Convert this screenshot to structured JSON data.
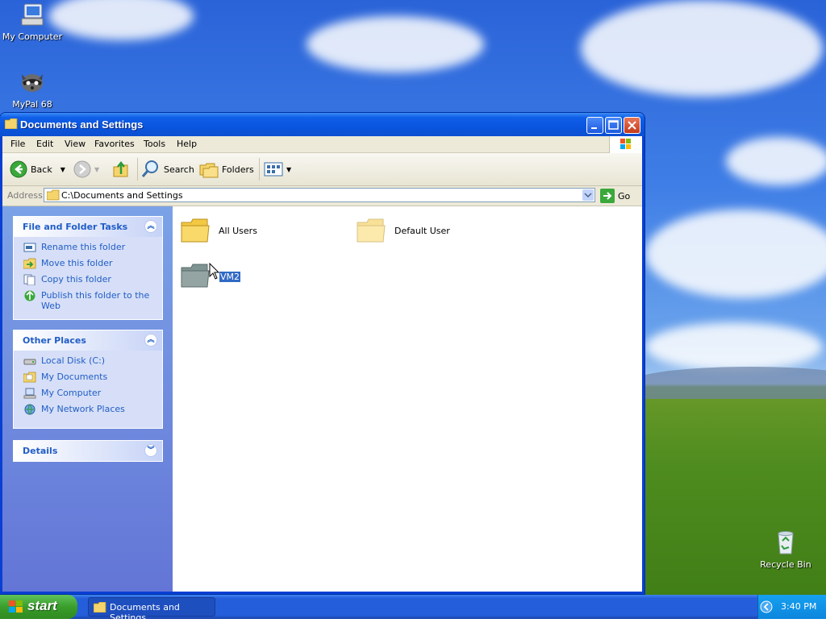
{
  "desktop": {
    "icons": [
      {
        "label": "My Computer",
        "icon": "my-computer-icon"
      },
      {
        "label": "MyPal 68",
        "icon": "mypal-raccoon-icon"
      },
      {
        "label": "Recycle Bin",
        "icon": "recycle-bin-icon"
      }
    ]
  },
  "window": {
    "title": "Documents and Settings",
    "menu": [
      "File",
      "Edit",
      "View",
      "Favorites",
      "Tools",
      "Help"
    ],
    "toolbar": {
      "back": "Back",
      "search": "Search",
      "folders": "Folders"
    },
    "address": {
      "label": "Address",
      "path": "C:\\Documents and Settings",
      "go": "Go"
    }
  },
  "tasks_panel": {
    "file_folder_tasks": {
      "title": "File and Folder Tasks",
      "items": [
        {
          "label": "Rename this folder",
          "icon": "rename-icon"
        },
        {
          "label": "Move this folder",
          "icon": "move-icon"
        },
        {
          "label": "Copy this folder",
          "icon": "copy-icon"
        },
        {
          "label": "Publish this folder to the Web",
          "icon": "publish-web-icon"
        }
      ]
    },
    "other_places": {
      "title": "Other Places",
      "items": [
        {
          "label": "Local Disk (C:)",
          "icon": "local-disk-icon"
        },
        {
          "label": "My Documents",
          "icon": "my-documents-icon"
        },
        {
          "label": "My Computer",
          "icon": "my-computer-icon"
        },
        {
          "label": "My Network Places",
          "icon": "network-places-icon"
        }
      ]
    },
    "details": {
      "title": "Details"
    }
  },
  "folders": [
    {
      "label": "All Users",
      "state": "normal"
    },
    {
      "label": "Default User",
      "state": "faded"
    },
    {
      "label": "VM2",
      "state": "selected"
    }
  ],
  "taskbar": {
    "start": "start",
    "task": "Documents and Settings",
    "clock": "3:40 PM"
  },
  "colors": {
    "titlebar": "#0a55df",
    "taskbar": "#245edb",
    "start": "#3a9d2b",
    "link": "#215dc6",
    "selection": "#316ac5"
  }
}
